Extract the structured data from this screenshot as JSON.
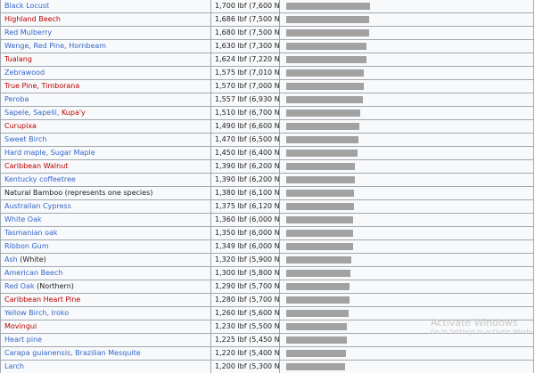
{
  "table": {
    "rows": [
      {
        "name": "Black Locust",
        "name_link": "blue",
        "note": "",
        "value": "1,700 lbf (7,600 N)",
        "lbf": 1700
      },
      {
        "name": "Highland Beech",
        "name_link": "red",
        "note": "",
        "value": "1,686 lbf (7,500 N)",
        "lbf": 1686
      },
      {
        "name": "Red Mulberry",
        "name_link": "blue",
        "note": "",
        "value": "1,680 lbf (7,500 N)",
        "lbf": 1680
      },
      {
        "name": "Wenge, Red Pine, Hornbeam",
        "name_link": "blue",
        "note": "",
        "value": "1,630 lbf (7,300 N)",
        "lbf": 1630
      },
      {
        "name": "Tualang",
        "name_link": "red",
        "note": "",
        "value": "1,624 lbf (7,220 N)",
        "lbf": 1624
      },
      {
        "name": "Zebrawood",
        "name_link": "blue",
        "note": "",
        "value": "1,575 lbf (7,010 N)",
        "lbf": 1575
      },
      {
        "name": "True Pine, Timborana",
        "name_link": "red",
        "note": "",
        "value": "1,570 lbf (7,000 N)",
        "lbf": 1570
      },
      {
        "name": "Peroba",
        "name_link": "blue",
        "note": "",
        "value": "1,557 lbf (6,930 N)",
        "lbf": 1557
      },
      {
        "name": "Sapele, Sapelli, ",
        "name_link": "blue",
        "note": "Kupa'y",
        "note_link": "red",
        "value": "1,510 lbf (6,700 N)",
        "lbf": 1510
      },
      {
        "name": "Curupixa",
        "name_link": "red",
        "note": "",
        "value": "1,490 lbf (6,600 N)",
        "lbf": 1490
      },
      {
        "name": "Sweet Birch",
        "name_link": "blue",
        "note": "",
        "value": "1,470 lbf (6,500 N)",
        "lbf": 1470
      },
      {
        "name": "Hard maple, Sugar Maple",
        "name_link": "blue",
        "note": "",
        "value": "1,450 lbf (6,400 N)",
        "lbf": 1450
      },
      {
        "name": "Caribbean Walnut",
        "name_link": "red",
        "note": "",
        "value": "1,390 lbf (6,200 N)",
        "lbf": 1390
      },
      {
        "name": "Kentucky coffeetree",
        "name_link": "blue",
        "note": "",
        "value": "1,390 lbf (6,200 N)",
        "lbf": 1390
      },
      {
        "name": "Natural Bamboo",
        "name_link": "plain",
        "note": " (represents one species)",
        "note_link": "plain",
        "value": "1,380 lbf (6,100 N)",
        "lbf": 1380
      },
      {
        "name": "Australian Cypress",
        "name_link": "blue",
        "note": "",
        "value": "1,375 lbf (6,120 N)",
        "lbf": 1375
      },
      {
        "name": "White Oak",
        "name_link": "blue",
        "note": "",
        "value": "1,360 lbf (6,000 N)",
        "lbf": 1360
      },
      {
        "name": "Tasmanian oak",
        "name_link": "blue",
        "note": "",
        "value": "1,350 lbf (6,000 N)",
        "lbf": 1350
      },
      {
        "name": "Ribbon Gum",
        "name_link": "blue",
        "note": "",
        "value": "1,349 lbf (6,000 N)",
        "lbf": 1349
      },
      {
        "name": "Ash",
        "name_link": "blue",
        "note": " (White)",
        "note_link": "plain",
        "value": "1,320 lbf (5,900 N)",
        "lbf": 1320
      },
      {
        "name": "American Beech",
        "name_link": "blue",
        "note": "",
        "value": "1,300 lbf (5,800 N)",
        "lbf": 1300
      },
      {
        "name": "Red Oak",
        "name_link": "blue",
        "note": " (Northern)",
        "note_link": "plain",
        "value": "1,290 lbf (5,700 N)",
        "lbf": 1290
      },
      {
        "name": "Caribbean Heart Pine",
        "name_link": "red",
        "note": "",
        "value": "1,280 lbf (5,700 N)",
        "lbf": 1280
      },
      {
        "name": "Yellow Birch, Iroko",
        "name_link": "blue",
        "note": "",
        "value": "1,260 lbf (5,600 N)",
        "lbf": 1260
      },
      {
        "name": "Movingui",
        "name_link": "red",
        "note": "",
        "value": "1,230 lbf (5,500 N)",
        "lbf": 1230
      },
      {
        "name": "Heart pine",
        "name_link": "blue",
        "note": "",
        "value": "1,225 lbf (5,450 N)",
        "lbf": 1225
      },
      {
        "name": "Carapa guianensis, Brazilian Mesquite",
        "name_link": "blue",
        "note": "",
        "value": "1,220 lbf (5,400 N)",
        "lbf": 1220
      },
      {
        "name": "Larch",
        "name_link": "blue",
        "note": "",
        "value": "1,200 lbf (5,300 N)",
        "lbf": 1200
      }
    ]
  },
  "watermark": {
    "title": "Activate Windows",
    "subtitle": "Go to Settings to activate Windo"
  },
  "colors": {
    "link_blue": "#3366cc",
    "link_red": "#ba0000",
    "bar_gray": "#a2a2a2",
    "border": "#a2a9b1",
    "cell_bg": "#f8f9fa"
  }
}
